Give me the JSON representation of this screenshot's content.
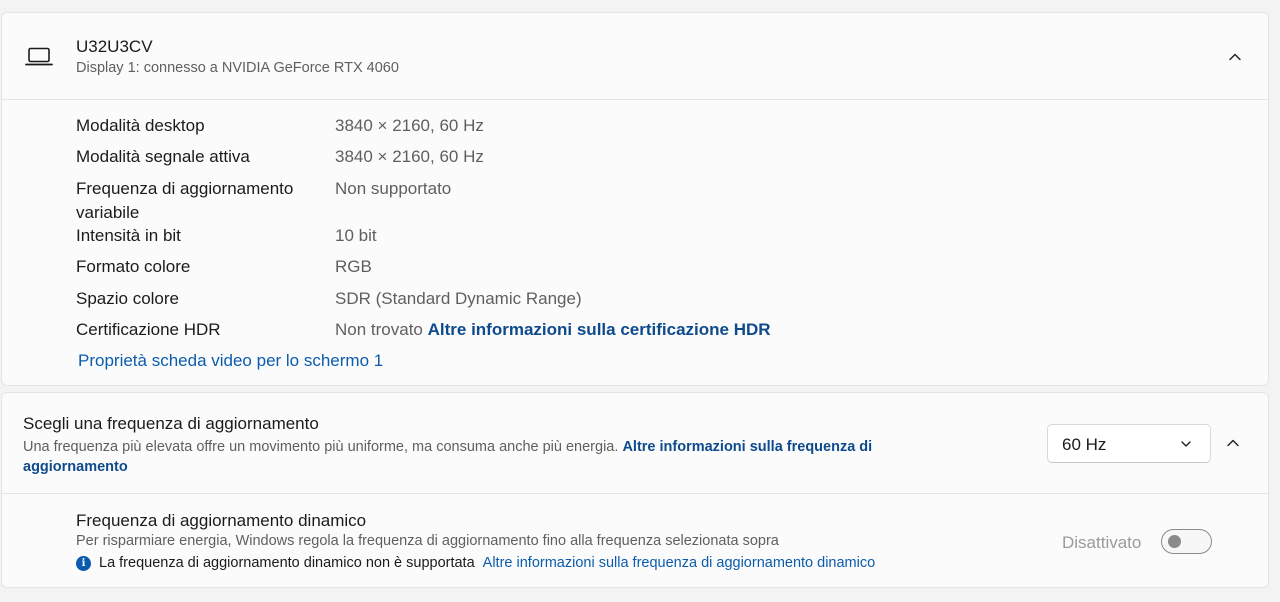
{
  "display": {
    "name": "U32U3CV",
    "subtitle": "Display 1: connesso a NVIDIA GeForce RTX 4060",
    "properties": [
      {
        "label": "Modalità desktop",
        "value": "3840 × 2160, 60 Hz"
      },
      {
        "label": "Modalità segnale attiva",
        "value": "3840 × 2160, 60 Hz"
      },
      {
        "label": "Frequenza di aggiornamento variabile",
        "value": "Non supportato"
      },
      {
        "label": "Intensità in bit",
        "value": "10 bit"
      },
      {
        "label": "Formato colore",
        "value": "RGB"
      },
      {
        "label": "Spazio colore",
        "value": "SDR (Standard Dynamic Range)"
      },
      {
        "label": "Certificazione HDR",
        "value": "Non trovato",
        "link": "Altre informazioni sulla certificazione HDR"
      }
    ],
    "adapter_link": "Proprietà scheda video per lo schermo 1"
  },
  "refresh": {
    "title": "Scegli una frequenza di aggiornamento",
    "description": "Una frequenza più elevata offre un movimento più uniforme, ma consuma anche più energia.",
    "description_link": "Altre informazioni sulla frequenza di aggiornamento",
    "selected": "60 Hz"
  },
  "dynamic": {
    "title": "Frequenza di aggiornamento dinamico",
    "description": "Per risparmiare energia, Windows regola la frequenza di aggiornamento fino alla frequenza selezionata sopra",
    "info_text": "La frequenza di aggiornamento dinamico non è supportata",
    "info_link": "Altre informazioni sulla frequenza di aggiornamento dinamico",
    "toggle_state": "Disattivato",
    "toggle_on": false
  },
  "colors": {
    "link": "#0b5cad",
    "link_dark": "#0e4a8c",
    "card_bg": "#fbfbfb",
    "page_bg": "#f3f3f3"
  },
  "icons": {
    "device": "laptop-icon",
    "collapse": "chevron-up-icon",
    "dropdown": "chevron-down-icon",
    "info": "info-icon"
  }
}
